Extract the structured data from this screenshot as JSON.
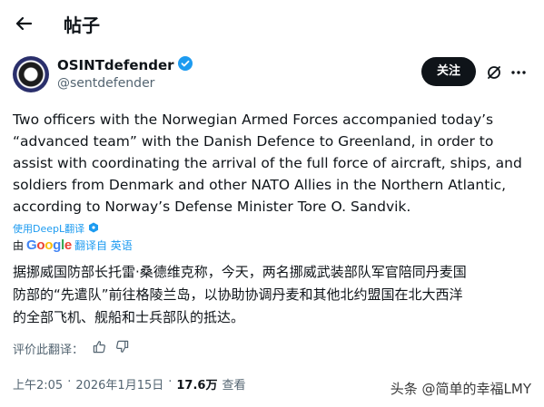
{
  "header": {
    "back_icon": "arrow-left-icon",
    "title": "帖子"
  },
  "author": {
    "display_name": "OSINTdefender",
    "handle": "@sentdefender",
    "verified_icon": "verified-badge-icon",
    "verified_color": "#1d9bf0"
  },
  "actions": {
    "follow_label": "关注",
    "grok_icon": "grok-icon",
    "more_icon": "more-icon"
  },
  "tweet": {
    "lines": [
      "Two officers with the Norwegian Armed Forces accompanied today’s",
      "“advanced team” with the Danish Defence to Greenland, in order to",
      "assist with coordinating the arrival of the full force of aircraft, ships, and",
      "soldiers from Denmark and other NATO Allies in the Northern Atlantic,",
      "according to Norway’s Defense Minister Tore O. Sandvik."
    ]
  },
  "deepl": {
    "label": "使用DeepL翻译"
  },
  "google": {
    "prefix": "由",
    "brand": "Google",
    "suffix": "翻译自 英语"
  },
  "translation": {
    "lines": [
      "据挪威国防部长托雷·桑德维克称，今天，两名挪威武装部队军官陪同丹麦国",
      "防部的“先遣队”前往格陵兰岛，以协助协调丹麦和其他北约盟国在北大西洋",
      "的全部飞机、舰船和士兵部队的抵达。"
    ]
  },
  "rating": {
    "label": "评价此翻译：",
    "up_icon": "thumbs-up-icon",
    "down_icon": "thumbs-down-icon"
  },
  "meta": {
    "time": "上午2:05",
    "separator": "·",
    "date": "2026年1月15日",
    "views": "17.6万",
    "views_label": "查看"
  },
  "watermark": "头条 @简单的幸福LMY"
}
